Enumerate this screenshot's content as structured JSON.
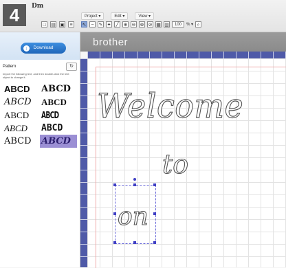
{
  "step": "4",
  "app": {
    "logo_text": "brother",
    "mini_logo": "Dm"
  },
  "menus": [
    "Project ▾",
    "Edit ▾",
    "View ▾"
  ],
  "toolbar": {
    "zoom_value": "100",
    "zoom_suffix": "% ▾"
  },
  "left_panel": {
    "download_label": "Download",
    "pattern_header": "Pattern",
    "refresh_icon": "refresh-icon",
    "instruction": "Import the following text, and then double-click the text object to change it.",
    "fonts": [
      {
        "label": "ABCD",
        "selected": false
      },
      {
        "label": "ABCD",
        "selected": false
      },
      {
        "label": "ABCD",
        "selected": false
      },
      {
        "label": "ABCD",
        "selected": false
      },
      {
        "label": "ABCD",
        "selected": false
      },
      {
        "label": "ABCD",
        "selected": false
      },
      {
        "label": "ABCD",
        "selected": false
      },
      {
        "label": "ABCD",
        "selected": false
      },
      {
        "label": "ABCD",
        "selected": false
      },
      {
        "label": "ABCD",
        "selected": true
      }
    ]
  },
  "canvas": {
    "texts": [
      "Welcome",
      "to",
      "on"
    ],
    "accent_color": "#4f5aa8"
  }
}
